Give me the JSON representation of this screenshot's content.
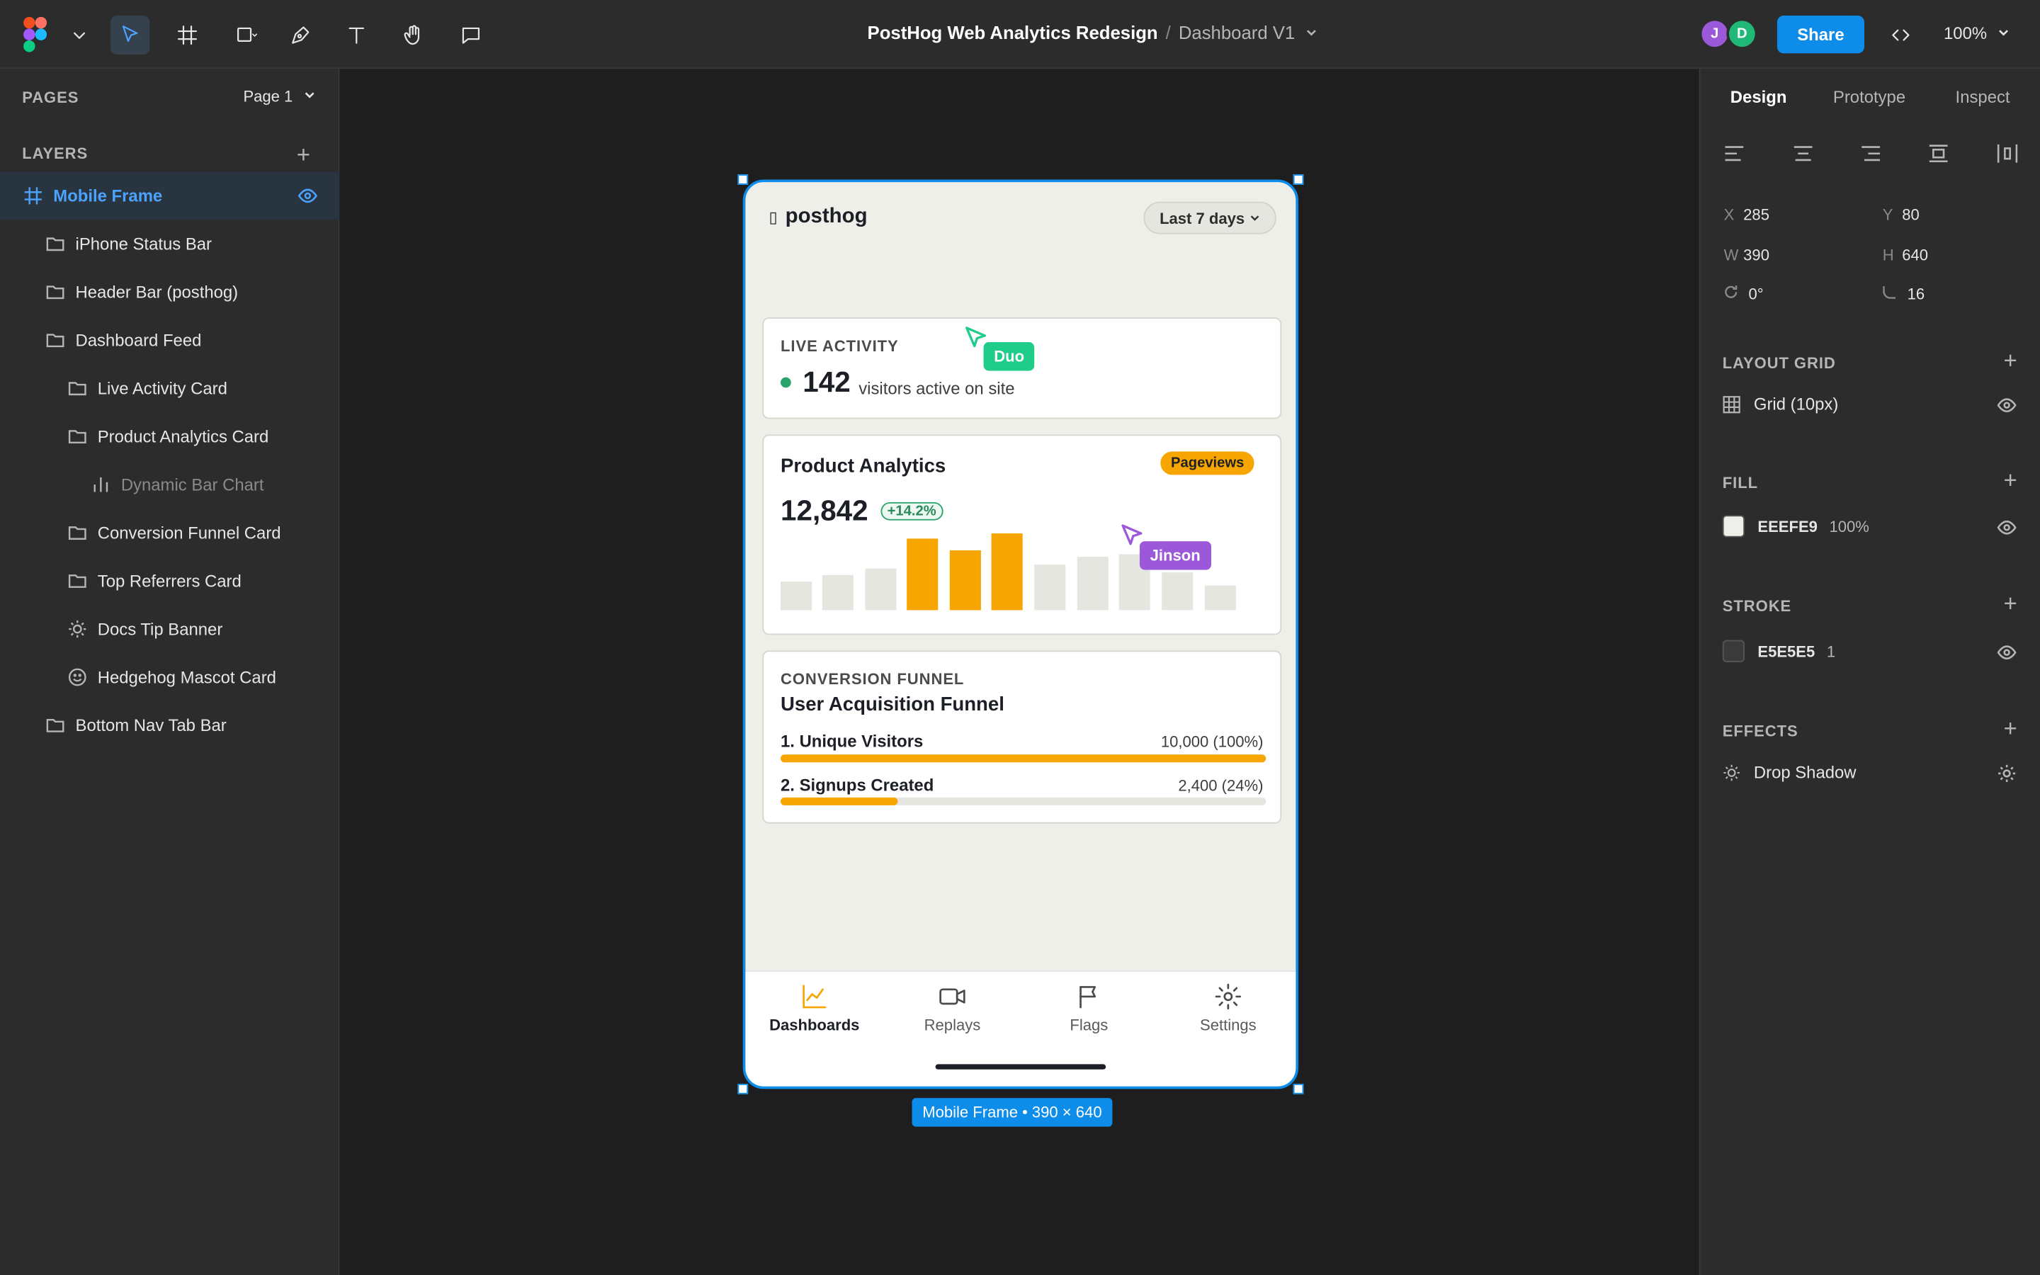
{
  "toolbar": {
    "file_title": "PostHog Web Analytics Redesign",
    "separator": "/",
    "page_name": "Dashboard V1",
    "avatars": [
      {
        "initial": "J",
        "color": "#9b59d9"
      },
      {
        "initial": "D",
        "color": "#1fb877"
      }
    ],
    "share_label": "Share",
    "zoom": "100%"
  },
  "left_panel": {
    "pages_label": "PAGES",
    "current_page": "Page 1",
    "layers_label": "LAYERS",
    "layers": [
      {
        "label": "Mobile Frame",
        "icon": "frame-icon"
      },
      {
        "label": "iPhone Status Bar",
        "icon": "folder-icon"
      },
      {
        "label": "Header Bar (posthog)",
        "icon": "folder-icon"
      },
      {
        "label": "Dashboard Feed",
        "icon": "folder-icon"
      },
      {
        "label": "Live Activity Card",
        "icon": "folder-icon"
      },
      {
        "label": "Product Analytics Card",
        "icon": "folder-icon"
      },
      {
        "label": "Dynamic Bar Chart",
        "icon": "bar-chart-icon"
      },
      {
        "label": "Conversion Funnel Card",
        "icon": "folder-icon"
      },
      {
        "label": "Top Referrers Card",
        "icon": "folder-icon"
      },
      {
        "label": "Docs Tip Banner",
        "icon": "sun-icon"
      },
      {
        "label": "Hedgehog Mascot Card",
        "icon": "smile-icon"
      },
      {
        "label": "Bottom Nav Tab Bar",
        "icon": "folder-icon"
      }
    ]
  },
  "phone": {
    "logo_text": "posthog",
    "date_range": "Last 7 days",
    "live": {
      "kicker": "LIVE ACTIVITY",
      "count": "142",
      "text": "visitors active on site"
    },
    "analytics": {
      "title": "Product Analytics",
      "badge": "Pageviews",
      "total": "12,842",
      "delta": "+14.2%"
    },
    "funnel": {
      "kicker": "CONVERSION FUNNEL",
      "title": "User Acquisition Funnel",
      "steps": [
        {
          "label": "1. Unique Visitors",
          "value": "10,000 (100%)",
          "fraction": 1.0
        },
        {
          "label": "2. Signups Created",
          "value": "2,400 (24%)",
          "fraction": 0.24
        }
      ]
    },
    "tabs": [
      {
        "label": "Dashboards",
        "icon": "chart-icon"
      },
      {
        "label": "Replays",
        "icon": "video-icon"
      },
      {
        "label": "Flags",
        "icon": "flag-icon"
      },
      {
        "label": "Settings",
        "icon": "gear-icon"
      }
    ]
  },
  "collaborators": [
    {
      "name": "Duo",
      "color": "#1fcc8a"
    },
    {
      "name": "Jinson",
      "color": "#9b59d9"
    }
  ],
  "frame_tag": "Mobile Frame • 390 × 640",
  "right_panel": {
    "tabs": [
      "Design",
      "Prototype",
      "Inspect"
    ],
    "props": {
      "x_label": "X",
      "x": "285",
      "y_label": "Y",
      "y": "80",
      "w_label": "W",
      "w": "390",
      "h_label": "H",
      "h": "640",
      "rotation": "0°",
      "radius": "16"
    },
    "layout_grid_label": "LAYOUT GRID",
    "grid_value": "Grid (10px)",
    "fill_label": "FILL",
    "fill_hex": "EEEFE9",
    "fill_opacity": "100%",
    "fill_color": "#eeefe9",
    "stroke_label": "STROKE",
    "stroke_hex": "E5E5E5",
    "stroke_width": "1",
    "stroke_color": "#3a3a3a",
    "effects_label": "EFFECTS",
    "effect_value": "Drop Shadow"
  }
}
